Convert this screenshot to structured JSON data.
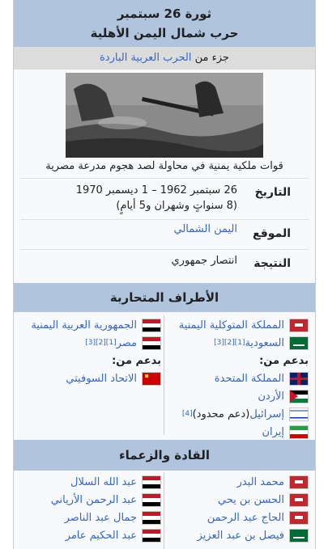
{
  "infobox": {
    "title": "ثورة 26 سبتمبر",
    "subtitle": "حرب شمال اليمن الأهلية",
    "part_of_prefix": "جزء من",
    "part_of_link": "الحرب العربية الباردة",
    "image_caption": "قوات ملكية يمنية في محاولة لصد هجوم مدرعة مصرية",
    "rows": [
      {
        "label": "التاريخ",
        "value_line1": "26 سبتمبر 1962 – 1 ديسمبر 1970",
        "value_line2": "(8 سنواتٍ وشهران و5 أيامٍ)"
      },
      {
        "label": "الموقع",
        "value": "اليمن الشمالي"
      },
      {
        "label": "النتيجة",
        "value": "انتصار جمهوري"
      }
    ],
    "belligerents_header": "الأطراف المتحاربة",
    "right_side": {
      "items": [
        {
          "name": "المملكة المتوكلية اليمنية",
          "flag": "yemen-kingdom"
        },
        {
          "name": "السعودية",
          "refs": "[1][2][3]",
          "flag": "saudi"
        }
      ],
      "support_label": "بدعم من:",
      "support": [
        {
          "name": "المملكة المتحدة",
          "flag": "uk"
        },
        {
          "name": "الأردن",
          "flag": "jordan"
        },
        {
          "name": "إسرائيل",
          "note": " (دعم محدود)",
          "refs": "[4]",
          "flag": "israel"
        },
        {
          "name": "إيران",
          "flag": "iran"
        }
      ]
    },
    "left_side": {
      "items": [
        {
          "name": "الجمهورية العربية اليمنية",
          "flag": "yar"
        },
        {
          "name": "مصر",
          "refs": "[1][2][3]",
          "flag": "egypt"
        }
      ],
      "support_label": "بدعم من:",
      "support": [
        {
          "name": "الاتحاد السوفيتي",
          "flag": "ussr"
        }
      ]
    },
    "commanders_header": "القادة والزعماء",
    "right_commanders": [
      {
        "name": "محمد البدر",
        "flag": "yemen-kingdom"
      },
      {
        "name": "الحسن بن يحي",
        "flag": "yemen-kingdom"
      },
      {
        "name": "الحاج عبد الرحمن",
        "flag": "yemen-kingdom"
      },
      {
        "name": "فيصل بن عبد العزيز",
        "flag": "saudi"
      }
    ],
    "left_commanders": [
      {
        "name": "عبد الله السلال",
        "flag": "yar"
      },
      {
        "name": "عبد الرحمن الأرياني",
        "flag": "yar"
      },
      {
        "name": "جمال عبد الناصر",
        "flag": "egypt"
      },
      {
        "name": "عبد الحكيم عامر",
        "flag": "egypt"
      }
    ]
  }
}
